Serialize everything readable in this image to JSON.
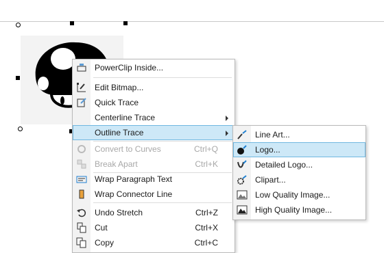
{
  "context_menu": {
    "items": [
      {
        "label": "PowerClip Inside...",
        "icon": "powerclip-icon"
      },
      {
        "label": "Edit Bitmap...",
        "icon": "edit-bitmap-icon"
      },
      {
        "label": "Quick Trace",
        "icon": "quick-trace-icon"
      },
      {
        "label": "Centerline Trace",
        "icon": ""
      },
      {
        "label": "Outline Trace",
        "icon": ""
      },
      {
        "label": "Convert to Curves",
        "shortcut": "Ctrl+Q",
        "icon": "convert-curves-icon",
        "disabled": true
      },
      {
        "label": "Break Apart",
        "shortcut": "Ctrl+K",
        "icon": "break-apart-icon",
        "disabled": true
      },
      {
        "label": "Wrap Paragraph Text",
        "icon": "wrap-paragraph-icon"
      },
      {
        "label": "Wrap Connector Line",
        "icon": "wrap-connector-icon"
      },
      {
        "label": "Undo Stretch",
        "shortcut": "Ctrl+Z",
        "icon": "undo-icon"
      },
      {
        "label": "Cut",
        "shortcut": "Ctrl+X",
        "icon": "cut-icon"
      },
      {
        "label": "Copy",
        "shortcut": "Ctrl+C",
        "icon": "copy-icon"
      }
    ]
  },
  "submenu": {
    "items": [
      {
        "label": "Line Art...",
        "icon": "line-art-icon"
      },
      {
        "label": "Logo...",
        "icon": "logo-icon"
      },
      {
        "label": "Detailed Logo...",
        "icon": "detailed-logo-icon"
      },
      {
        "label": "Clipart...",
        "icon": "clipart-icon"
      },
      {
        "label": "Low Quality Image...",
        "icon": "low-quality-image-icon"
      },
      {
        "label": "High Quality Image...",
        "icon": "high-quality-image-icon"
      }
    ]
  },
  "colors": {
    "highlight": "#cde8f7",
    "highlight_border": "#6fb7e0",
    "disabled": "#a8a8a8"
  }
}
